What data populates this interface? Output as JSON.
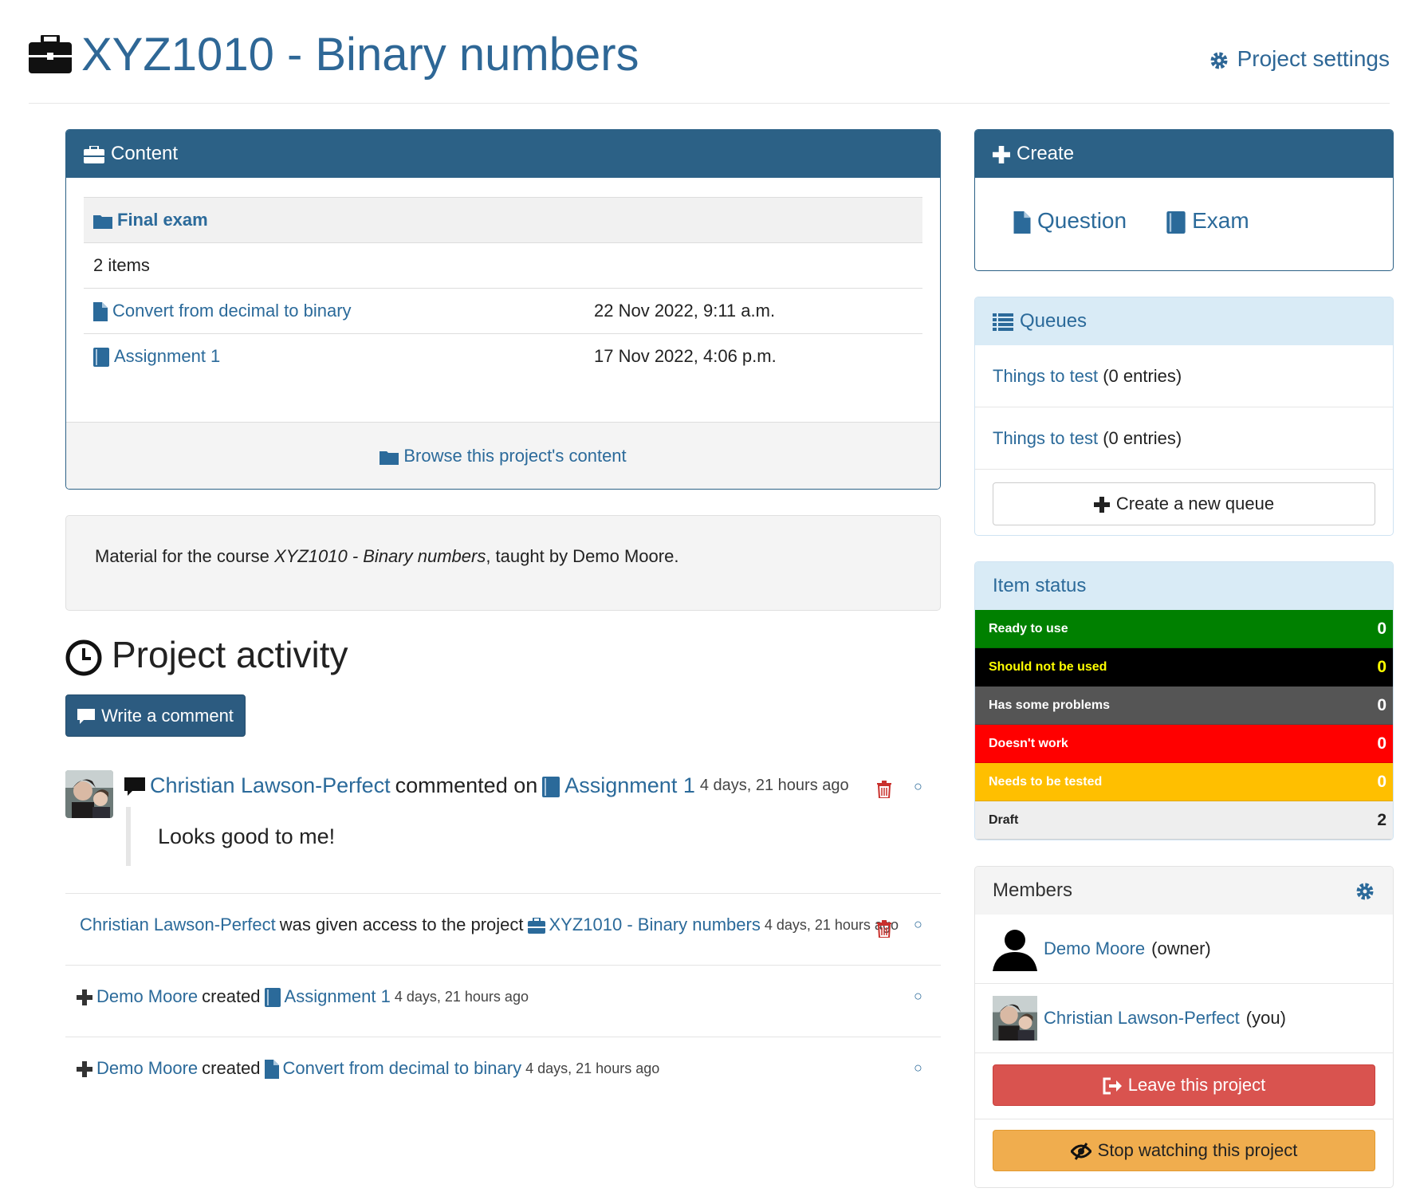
{
  "header": {
    "title": "XYZ1010 - Binary numbers",
    "settings_label": "Project settings"
  },
  "content_panel": {
    "title": "Content",
    "folder_name": "Final exam",
    "item_count": "2 items",
    "items": [
      {
        "name": "Convert from decimal to binary",
        "date": "22 Nov 2022, 9:11 a.m.",
        "icon": "question-file-icon"
      },
      {
        "name": "Assignment 1",
        "date": "17 Nov 2022, 4:06 p.m.",
        "icon": "exam-book-icon"
      }
    ],
    "browse_label": "Browse this project's content"
  },
  "description": {
    "prefix": "Material for the course ",
    "course": "XYZ1010 - Binary numbers",
    "suffix": ", taught by Demo Moore."
  },
  "activity": {
    "heading": "Project activity",
    "write_comment_label": "Write a comment",
    "comment": {
      "user": "Christian Lawson-Perfect",
      "verb": "commented on",
      "target": "Assignment 1",
      "time": "4 days, 21 hours ago",
      "text": "Looks good to me!"
    },
    "events": [
      {
        "user": "Christian Lawson-Perfect",
        "verb": "was given access to the project",
        "target": "XYZ1010 - Binary numbers",
        "time": "4 days, 21 hours ago"
      },
      {
        "user": "Demo Moore",
        "verb": "created",
        "target": "Assignment 1",
        "time": "4 days, 21 hours ago"
      },
      {
        "user": "Demo Moore",
        "verb": "created",
        "target": "Convert from decimal to binary",
        "time": "4 days, 21 hours ago"
      }
    ],
    "circle_glyph": "○"
  },
  "create_panel": {
    "title": "Create",
    "question_label": "Question",
    "exam_label": "Exam"
  },
  "queues_panel": {
    "title": "Queues",
    "queues": [
      {
        "name": "Things to test",
        "entries": "(0 entries)"
      },
      {
        "name": "Things to test",
        "entries": "(0 entries)"
      }
    ],
    "new_queue_label": "Create a new queue"
  },
  "status_panel": {
    "title": "Item status",
    "statuses": [
      {
        "label": "Ready to use",
        "count": "0",
        "bg": "#008000",
        "fg": "#ffffff"
      },
      {
        "label": "Should not be used",
        "count": "0",
        "bg": "#000000",
        "fg": "#ffff00"
      },
      {
        "label": "Has some problems",
        "count": "0",
        "bg": "#555555",
        "fg": "#ffffff"
      },
      {
        "label": "Doesn't work",
        "count": "0",
        "bg": "#ff0000",
        "fg": "#ffffff"
      },
      {
        "label": "Needs to be tested",
        "count": "0",
        "bg": "#ffbf00",
        "fg": "#ffffff"
      },
      {
        "label": "Draft",
        "count": "2",
        "bg": "#eeeeee",
        "fg": "#222222"
      }
    ]
  },
  "members_panel": {
    "title": "Members",
    "members": [
      {
        "name": "Demo Moore",
        "role": "(owner)"
      },
      {
        "name": "Christian Lawson-Perfect",
        "role": "(you)"
      }
    ],
    "leave_label": "Leave this project",
    "watch_label": "Stop watching this project"
  },
  "colors": {
    "primary": "#2c6186",
    "link": "#2b6a9a",
    "danger": "#d9534f",
    "warning": "#f0ad4e"
  }
}
